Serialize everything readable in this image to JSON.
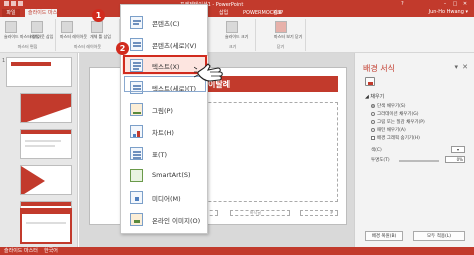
{
  "window": {
    "title": "프레젠테이션1 - PowerPoint",
    "help": "?",
    "min": "–",
    "max": "□",
    "close": "✕"
  },
  "tabs": {
    "file": "파일",
    "active": "슬라이드 마스터",
    "t3": "홈",
    "t4": "삽입",
    "t5": "POWERMOCKUP",
    "t6": "검토",
    "user": "Jun-Ho Hwang ▾"
  },
  "ribbon": {
    "groups": [
      {
        "label": "마스터 편집",
        "buttons": [
          "슬라이드 마스터 삽입",
          "레이아웃 삽입"
        ]
      },
      {
        "label": "마스터 레이아웃",
        "buttons": [
          "마스터 레이아웃",
          "개체 틀 삽입"
        ]
      },
      {
        "label": "크기",
        "buttons": [
          "슬라이드 크기"
        ]
      },
      {
        "label": "닫기",
        "buttons": [
          "마스터 보기 닫기"
        ]
      }
    ]
  },
  "thumbnails": {
    "master_num": "1",
    "nums": [
      "",
      "",
      "",
      "",
      "",
      ""
    ]
  },
  "slide": {
    "title": "마스터 제목 스타일 편집",
    "title_visible": "이탈례",
    "footer_left": "날짜",
    "footer_mid": "바닥글",
    "footer_right": "#"
  },
  "dropdown": {
    "items": [
      {
        "label": "콘텐츠(C)",
        "icon": "content-icon"
      },
      {
        "label": "콘텐츠(세로)(V)",
        "icon": "content-vertical-icon"
      },
      {
        "label": "텍스트(X)",
        "icon": "text-icon"
      },
      {
        "label": "텍스트(세로)(T)",
        "icon": "text-vertical-icon"
      },
      {
        "label": "그림(P)",
        "icon": "picture-icon"
      },
      {
        "label": "차트(H)",
        "icon": "chart-icon"
      },
      {
        "label": "표(T)",
        "icon": "table-icon"
      },
      {
        "label": "SmartArt(S)",
        "icon": "smartart-icon"
      },
      {
        "label": "미디어(M)",
        "icon": "media-icon"
      },
      {
        "label": "온라인 이미지(O)",
        "icon": "online-image-icon"
      }
    ]
  },
  "callouts": {
    "one": "1",
    "two": "2"
  },
  "format_pane": {
    "title": "배경 서식",
    "pin": "▾",
    "close": "✕",
    "section": "◢ 채우기",
    "options": [
      "단색 채우기(S)",
      "그라데이션 채우기(G)",
      "그림 또는 질감 채우기(P)",
      "패턴 채우기(A)",
      "배경 그래픽 숨기기(H)"
    ],
    "color_label": "색(C)",
    "transparency_label": "투명도(T)",
    "transparency_value": "0%",
    "reset_button": "배경 복원(B)",
    "apply_all_button": "모두 적용(L)"
  },
  "status": {
    "view": "슬라이드 마스터",
    "lang": "한국어"
  },
  "colors": {
    "accent": "#c23a2c",
    "highlight": "#d12b1e"
  }
}
